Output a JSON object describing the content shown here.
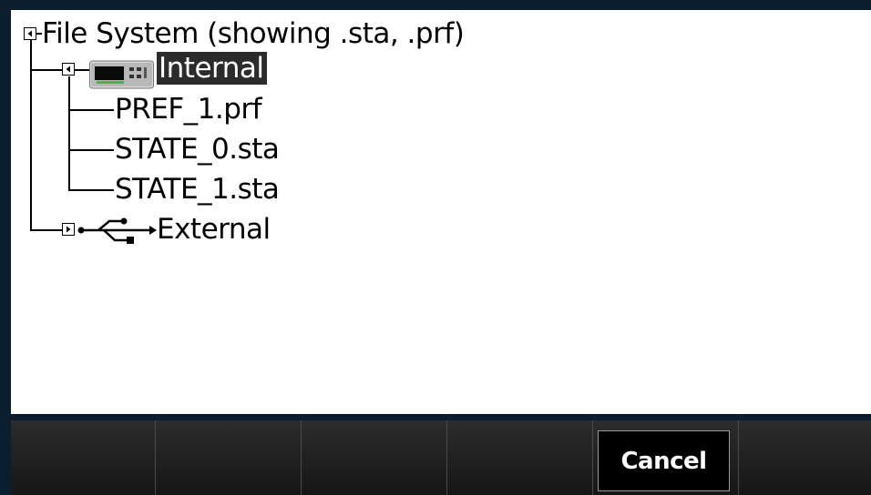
{
  "dialog": {
    "root_label": "File System (showing .sta, .prf)"
  },
  "tree": {
    "internal": {
      "label": "Internal",
      "icon": "instrument-icon",
      "files": [
        "PREF_1.prf",
        "STATE_0.sta",
        "STATE_1.sta"
      ]
    },
    "external": {
      "label": "External",
      "icon": "usb-icon"
    }
  },
  "softkeys": {
    "cancel_label": "Cancel"
  },
  "colors": {
    "frame": "#0b1e2e",
    "panel": "#ffffff",
    "selection": "#2b2b2b"
  }
}
